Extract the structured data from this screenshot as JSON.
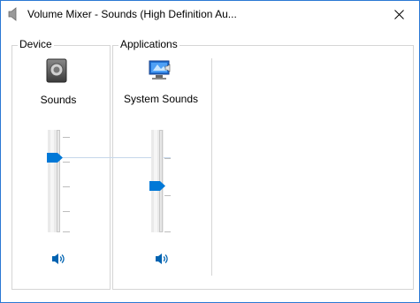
{
  "window": {
    "title": "Volume Mixer - Sounds (High Definition Au...",
    "border_color": "#2b78d4"
  },
  "device": {
    "group_label": "Device",
    "name": "Sounds",
    "icon": "speaker-device-icon",
    "volume_level": 0.75,
    "mute_icon": "speaker-icon"
  },
  "applications": {
    "group_label": "Applications",
    "items": [
      {
        "name": "System Sounds",
        "icon": "system-sounds-icon",
        "volume_level": 0.45,
        "mute_icon": "speaker-icon"
      }
    ]
  },
  "colors": {
    "accent": "#0078d7",
    "group_border": "#d5d5d5"
  }
}
